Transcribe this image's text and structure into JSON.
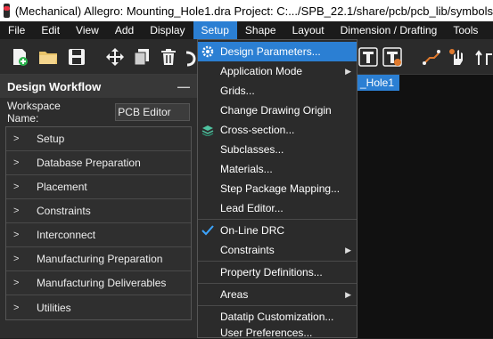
{
  "window": {
    "title": "(Mechanical) Allegro: Mounting_Hole1.dra  Project: C:.../SPB_22.1/share/pcb/pcb_lib/symbols"
  },
  "menubar": [
    "File",
    "Edit",
    "View",
    "Add",
    "Display",
    "Setup",
    "Shape",
    "Layout",
    "Dimension / Drafting",
    "Tools"
  ],
  "toolbar": {
    "icons": [
      "new-icon",
      "open-icon",
      "save-icon",
      "move-icon",
      "copy-icon",
      "delete-icon",
      "undo-icon",
      "text-icon",
      "text-edit-icon",
      "route-icon",
      "drag-icon",
      "slide-icon"
    ]
  },
  "panel": {
    "title": "Design Workflow",
    "minimize": "—",
    "workspace_label": "Workspace Name:",
    "workspace_value": "PCB Editor",
    "items": [
      "Setup",
      "Database Preparation",
      "Placement",
      "Constraints",
      "Interconnect",
      "Manufacturing Preparation",
      "Manufacturing Deliverables",
      "Utilities"
    ]
  },
  "tab": {
    "label": "_Hole1"
  },
  "setup_menu": {
    "items": [
      {
        "label": "Design Parameters...",
        "icon": "design-parameters-icon",
        "highlighted": true
      },
      {
        "label": "Application Mode",
        "submenu": true
      },
      {
        "label": "Grids..."
      },
      {
        "label": "Change Drawing Origin"
      },
      {
        "label": "Cross-section...",
        "icon": "cross-section-icon"
      },
      {
        "label": "Subclasses..."
      },
      {
        "label": "Materials..."
      },
      {
        "label": "Step Package Mapping..."
      },
      {
        "label": "Lead Editor..."
      },
      {
        "label": "On-Line DRC",
        "icon": "checkmark-icon",
        "checked": true
      },
      {
        "label": "Constraints",
        "submenu": true
      },
      {
        "label": "Property Definitions..."
      },
      {
        "label": "Areas",
        "submenu": true
      },
      {
        "label": "Datatip Customization..."
      },
      {
        "label": "User Preferences..."
      }
    ]
  }
}
